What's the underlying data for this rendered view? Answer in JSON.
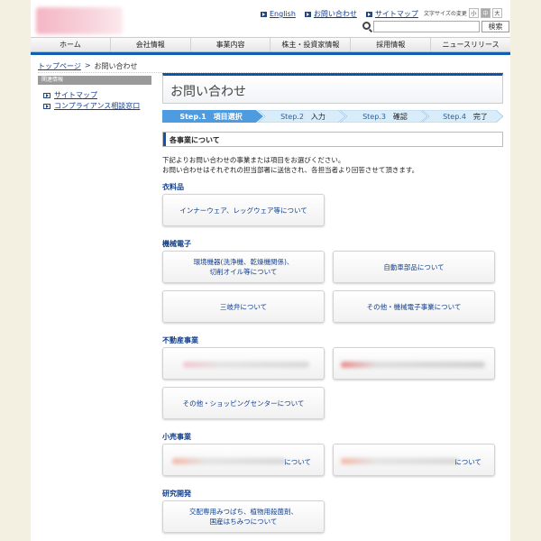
{
  "header": {
    "toplinks": [
      "English",
      "お問い合わせ",
      "サイトマップ"
    ],
    "fontsize_label": "文字サイズの変更",
    "fontsize_options": [
      "小",
      "中",
      "大"
    ],
    "fontsize_active": "中",
    "search_value": "",
    "search_button": "検索"
  },
  "gnav": [
    "ホーム",
    "会社情報",
    "事業内容",
    "株主・投資家情報",
    "採用情報",
    "ニュースリリース"
  ],
  "breadcrumb": {
    "home": "トップページ",
    "sep": ">",
    "current": "お問い合わせ"
  },
  "sidebar": {
    "heading": "関連情報",
    "items": [
      "サイトマップ",
      "コンプライアンス相談窓口"
    ]
  },
  "main": {
    "title": "お問い合わせ",
    "steps": [
      {
        "num": "Step.1",
        "label": "項目選択",
        "active": true
      },
      {
        "num": "Step.2",
        "label": "入力",
        "active": false
      },
      {
        "num": "Step.3",
        "label": "確認",
        "active": false
      },
      {
        "num": "Step.4",
        "label": "完了",
        "active": false
      }
    ],
    "section_heading": "各事業について",
    "intro": [
      "下記よりお問い合わせの事業または項目をお選びください。",
      "お問い合わせはそれぞれの担当部署に送信され、各担当者より回答させて頂きます。"
    ],
    "categories": {
      "clothing": {
        "title": "衣料品",
        "cards": [
          "インナーウェア、レッグウェア等について"
        ]
      },
      "machinery": {
        "title": "機械電子",
        "cards": [
          "環境機器(洗浄機、乾燥機関係)、\n切削オイル等について",
          "自動車部品について",
          "三岐弁について",
          "その他・機械電子事業について"
        ]
      },
      "realestate": {
        "title": "不動産事業",
        "cards": [
          "その他・ショッピングセンターについて"
        ]
      },
      "retail": {
        "title": "小売事業",
        "cards": [
          "について",
          "について"
        ]
      },
      "research": {
        "title": "研究開発",
        "cards": [
          "交配専用みつばち、植物用殺菌剤、\n国産はちみつについて"
        ]
      }
    }
  },
  "colors": {
    "accent": "#0d55aa",
    "link": "#123e8c",
    "step_active": "#4f9be0",
    "step_inactive": "#d9ecf9",
    "background": "#f3efe1"
  }
}
